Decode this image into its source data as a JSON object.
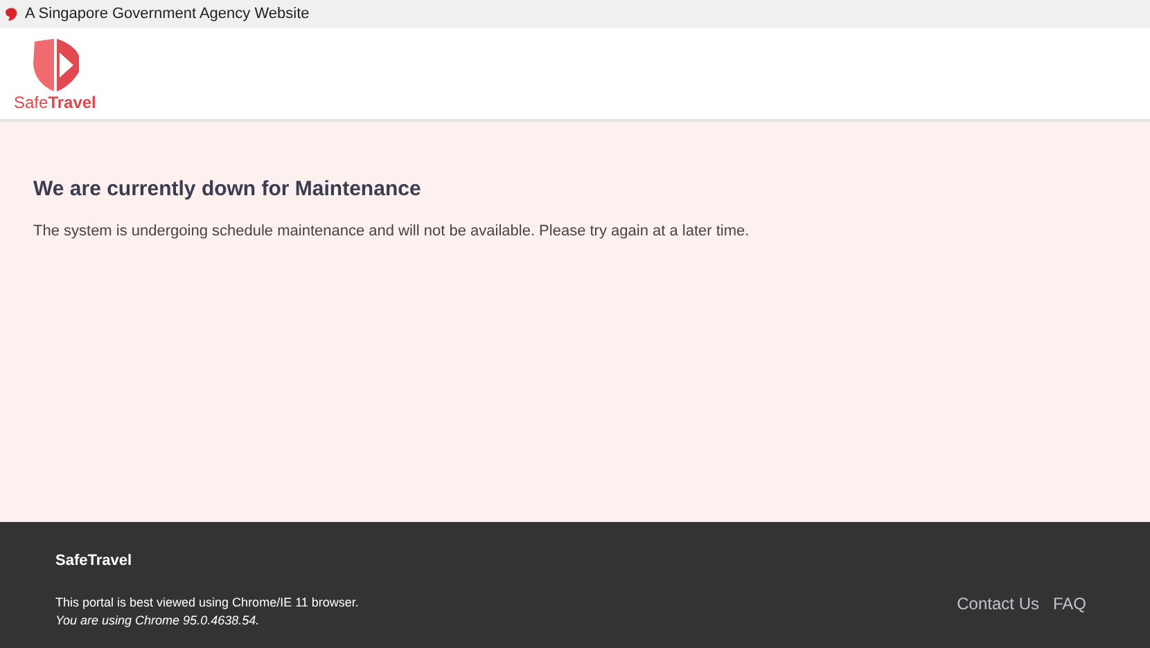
{
  "masthead": {
    "text": "A Singapore Government Agency Website"
  },
  "header": {
    "logo_text": "Safe**Travel**"
  },
  "main": {
    "title": "We are currently down for Maintenance",
    "message": "The system is undergoing schedule maintenance and will not be available. Please try again at a later time."
  },
  "footer": {
    "brand": "SafeTravel",
    "note": "This portal is best viewed using Chrome/IE 11 browser.",
    "browser_info": "You are using Chrome 95.0.4638.54.",
    "links": [
      "Contact Us",
      "FAQ"
    ]
  }
}
